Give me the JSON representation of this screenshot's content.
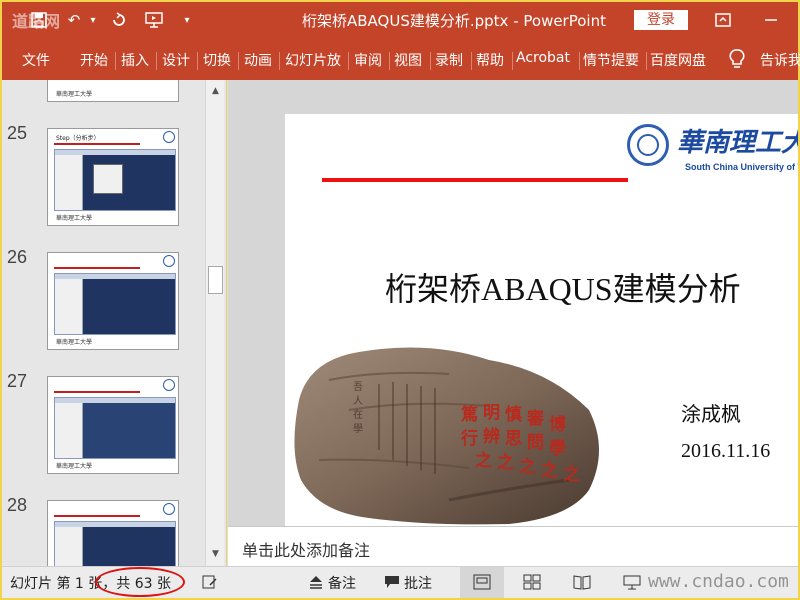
{
  "app": {
    "title": "桁架桥ABAQUS建模分析.pptx - PowerPoint",
    "login_label": "登录",
    "watermark_top": "道路网",
    "accent_color": "#c4442a"
  },
  "ribbon": {
    "tabs": [
      "文件",
      "开始",
      "插入",
      "设计",
      "切换",
      "动画",
      "幻灯片放",
      "审阅",
      "视图",
      "录制",
      "帮助",
      "Acrobat",
      "情节提要",
      "百度网盘"
    ],
    "tell_me": "告诉我"
  },
  "thumbnails": {
    "items": [
      {
        "number": "25",
        "caption": "Step（分析步）"
      },
      {
        "number": "26",
        "caption": ""
      },
      {
        "number": "27",
        "caption": ""
      },
      {
        "number": "28",
        "caption": ""
      }
    ],
    "footer_text": "華南理工大學"
  },
  "slide": {
    "university_cn": "華南理工大",
    "university_en": "South China University of T",
    "title": "桁架桥ABAQUS建模分析",
    "author": "涂成枫",
    "date": "2016.11.16",
    "stone_text_right": [
      "篤",
      "明",
      "慎",
      "審",
      "博",
      "行",
      "辨",
      "思",
      "問",
      "學",
      "之",
      "之",
      "之",
      "之",
      "之"
    ],
    "stone_text_left": [
      "吾",
      "人",
      "在",
      "學"
    ]
  },
  "notes": {
    "placeholder": "单击此处添加备注"
  },
  "statusbar": {
    "slide_info": "幻灯片 第 1 张，共 63 张",
    "notes_label": "备注",
    "comments_label": "批注",
    "watermark": "www.cndao.com"
  }
}
